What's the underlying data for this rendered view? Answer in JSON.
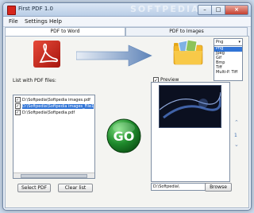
{
  "window": {
    "title": "First PDF 1.0",
    "watermark": "SOFTPEDIA",
    "controls": {
      "minimize": "–",
      "maximize": "□",
      "close": "×"
    }
  },
  "menu": [
    "File",
    "Settings",
    "Help"
  ],
  "tabs": [
    {
      "label": "PDF to Word",
      "active": true
    },
    {
      "label": "PDF to Images",
      "active": false
    }
  ],
  "format": {
    "selected": "Png",
    "options": [
      "Png",
      "Jpeg",
      "Gif",
      "Bmp",
      "Tiff",
      "Multi-P. Tiff"
    ],
    "highlighted": "Png"
  },
  "file_list": {
    "label": "List with PDF files:",
    "items": [
      {
        "text": "D:\\Softpedia\\Softpedia images.pdf",
        "checked": true,
        "selected": false
      },
      {
        "text": "D:\\Softpedia\\Softpedia images_File1",
        "checked": true,
        "selected": true
      },
      {
        "text": "D:\\Softpedia\\Softpedia.pdf",
        "checked": true,
        "selected": false
      }
    ]
  },
  "buttons": {
    "select_pdf": "Select PDF",
    "clear_list": "Clear list",
    "go": "GO",
    "browse": "Browse"
  },
  "preview": {
    "label": "Preview",
    "checked": true,
    "page": "1"
  },
  "output_path": "D:\\Softpedia\\",
  "colors": {
    "accent": "#3174d6",
    "go_green": "#1f8a2c",
    "pdf_red": "#d6261c",
    "arrow_blue": "#5f84b8"
  },
  "icons": [
    "pdf-icon",
    "arrow-right-icon",
    "folder-icon",
    "go-icon",
    "chevron-up-icon",
    "chevron-down-icon"
  ]
}
